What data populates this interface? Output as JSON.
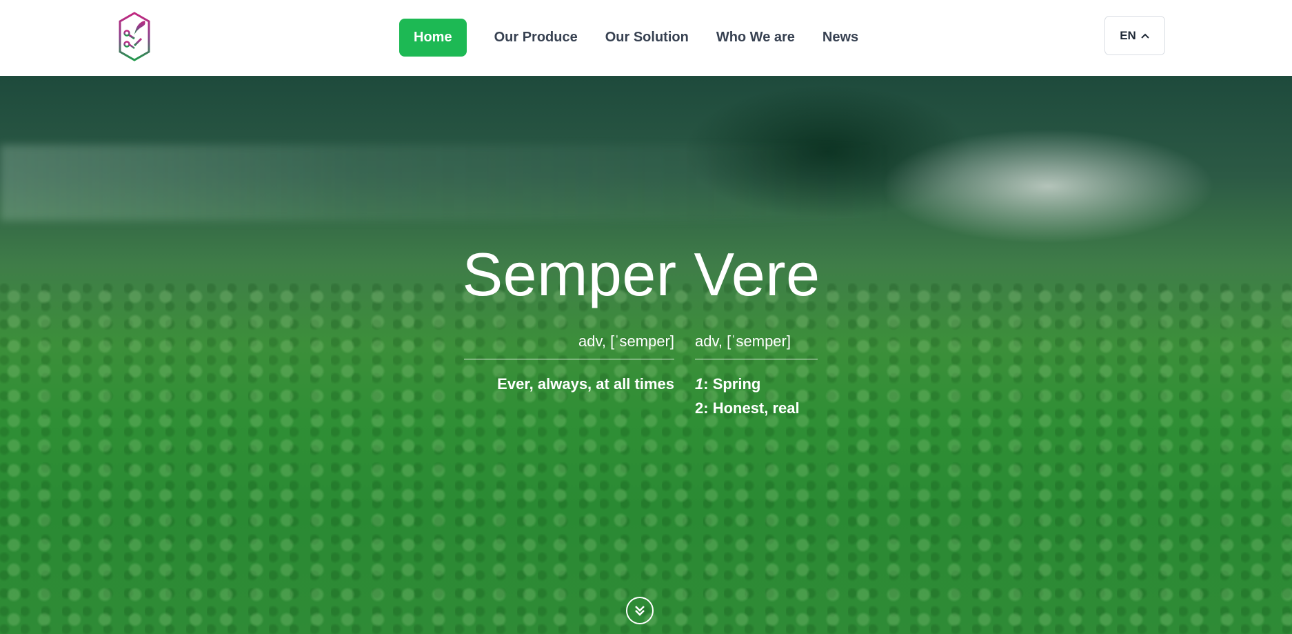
{
  "nav": {
    "logo_icon": "leaf-tree-logo-icon",
    "items": [
      {
        "label": "Home",
        "active": true
      },
      {
        "label": "Our Produce",
        "active": false
      },
      {
        "label": "Our Solution",
        "active": false
      },
      {
        "label": "Who We are",
        "active": false
      },
      {
        "label": "News",
        "active": false
      }
    ],
    "language": "EN",
    "language_icon": "chevron-up-icon"
  },
  "hero": {
    "title": "Semper Vere",
    "left": {
      "pronunciation": "adv, [ˈsemper]",
      "meaning": "Ever, always, at all times"
    },
    "right": {
      "pronunciation": "adv, [ˈsemper]",
      "meanings": [
        {
          "num": "1",
          "text": ": Spring"
        },
        {
          "num": "2",
          "text": ": Honest, real"
        }
      ]
    },
    "scroll_icon": "double-chevron-down-icon"
  },
  "colors": {
    "accent": "#1db954",
    "nav_text": "#374151",
    "hero_text": "#ffffff"
  }
}
